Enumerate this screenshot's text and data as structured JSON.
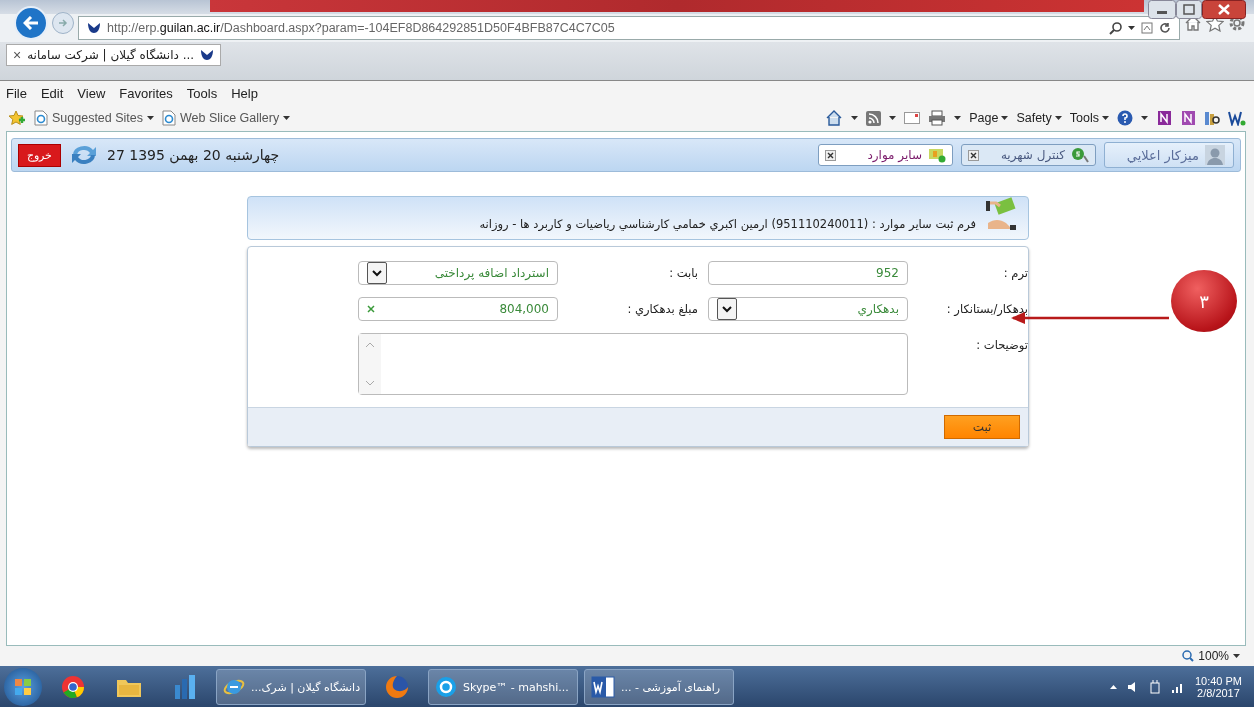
{
  "browser": {
    "address": "http://erp.**guilan.ac.ir**/Dashboard.aspx?param=-104EF8D864292851D50F4BFB87C4C7C05",
    "tab": {
      "title": "... دانشگاه گیلان | شرکت سامانه",
      "close": "×"
    },
    "menu": [
      "Help",
      "Tools",
      "Favorites",
      "View",
      "Edit",
      "File"
    ],
    "favorites": [
      "Web Slice Gallery",
      "Suggested Sites"
    ],
    "commands": [
      "Tools",
      "Safety",
      "Page"
    ],
    "zoom": "100%"
  },
  "app_header": {
    "user": "ميزكار اعلايي",
    "tabs": [
      {
        "label": "كنترل شهريه",
        "selected": false
      },
      {
        "label": "ساير موارد",
        "selected": true
      }
    ],
    "date": "چهارشنبه 20 بهمن 1395 27",
    "logout": "خروج"
  },
  "form": {
    "title": "فرم ثبت ساير موارد : (951110240011) ارمين اكبري خمامي كارشناسي رياضيات و كاربرد ها - روزانه",
    "fields": [
      {
        "kind": "text",
        "label": "ترم :",
        "value": "952"
      },
      {
        "kind": "select",
        "label": "بابت :",
        "value": "استرداد اضافه پرداختی"
      },
      {
        "kind": "select",
        "label": "بدهكار/بستانكار :",
        "value": "بدهكاري"
      },
      {
        "kind": "clearable",
        "label": "مبلغ بدهكاري :",
        "value": "804,000"
      },
      {
        "kind": "textarea",
        "label": "توضيحات :"
      }
    ],
    "submit": "ثبت"
  },
  "callout": {
    "label": "۳"
  },
  "taskbar": {
    "items": [
      {
        "kind": "word",
        "label": "... - راهنمای آموزشی"
      },
      {
        "kind": "skype",
        "label": "Skype™ - mahshi..."
      },
      {
        "kind": "firefox"
      },
      {
        "kind": "ie",
        "label": "...دانشگاه گیلان | شرک"
      },
      {
        "kind": "chart"
      },
      {
        "kind": "folder"
      },
      {
        "kind": "chrome"
      }
    ],
    "time": "10:40 PM",
    "date": "2/8/2017"
  }
}
